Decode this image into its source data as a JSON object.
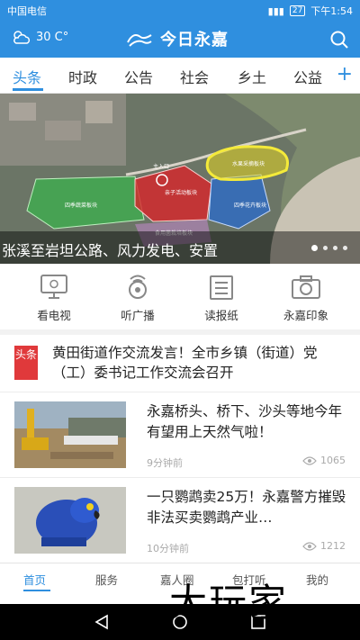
{
  "status_bar": {
    "carrier": "中国电信",
    "battery": "27",
    "time": "下午1:54"
  },
  "header": {
    "temperature": "30 C°",
    "weather_icon": "partly-cloudy-icon",
    "title": "今日永嘉",
    "logo_icon": "yongjia-logo-icon",
    "search_icon": "search-icon"
  },
  "tabs": [
    "头条",
    "时政",
    "公告",
    "社会",
    "乡土",
    "公益"
  ],
  "banner": {
    "caption": "张溪至岩坦公路、风力发电、安置",
    "map_labels": {
      "entrance": "主入口",
      "fruit": "水果采摘板块",
      "parent_child": "亲子活动板块",
      "vegetable": "四季蔬菜板块",
      "flower": "四季花卉板块",
      "sightseeing": "食用菌栽培板块"
    }
  },
  "quick_links": [
    {
      "label": "看电视",
      "icon": "tv-icon"
    },
    {
      "label": "听广播",
      "icon": "radio-icon"
    },
    {
      "label": "读报纸",
      "icon": "newspaper-icon"
    },
    {
      "label": "永嘉印象",
      "icon": "camera-icon"
    }
  ],
  "headline": {
    "badge": "头条",
    "text": "黄田街道作交流发言！全市乡镇（街道）党（工）委书记工作交流会召开"
  },
  "news": [
    {
      "title": "永嘉桥头、桥下、沙头等地今年有望用上天然气啦！",
      "time": "9分钟前",
      "views": "1065"
    },
    {
      "title": "一只鹦鹉卖25万！永嘉警方摧毁非法买卖鹦鹉产业…",
      "time": "10分钟前",
      "views": "1212"
    }
  ],
  "bottom_nav": [
    "首页",
    "服务",
    "嘉人圈",
    "包打听",
    "我的"
  ],
  "watermark": "大玩家",
  "colors": {
    "accent": "#2f8fdf",
    "badge_red": "#e0393b"
  }
}
